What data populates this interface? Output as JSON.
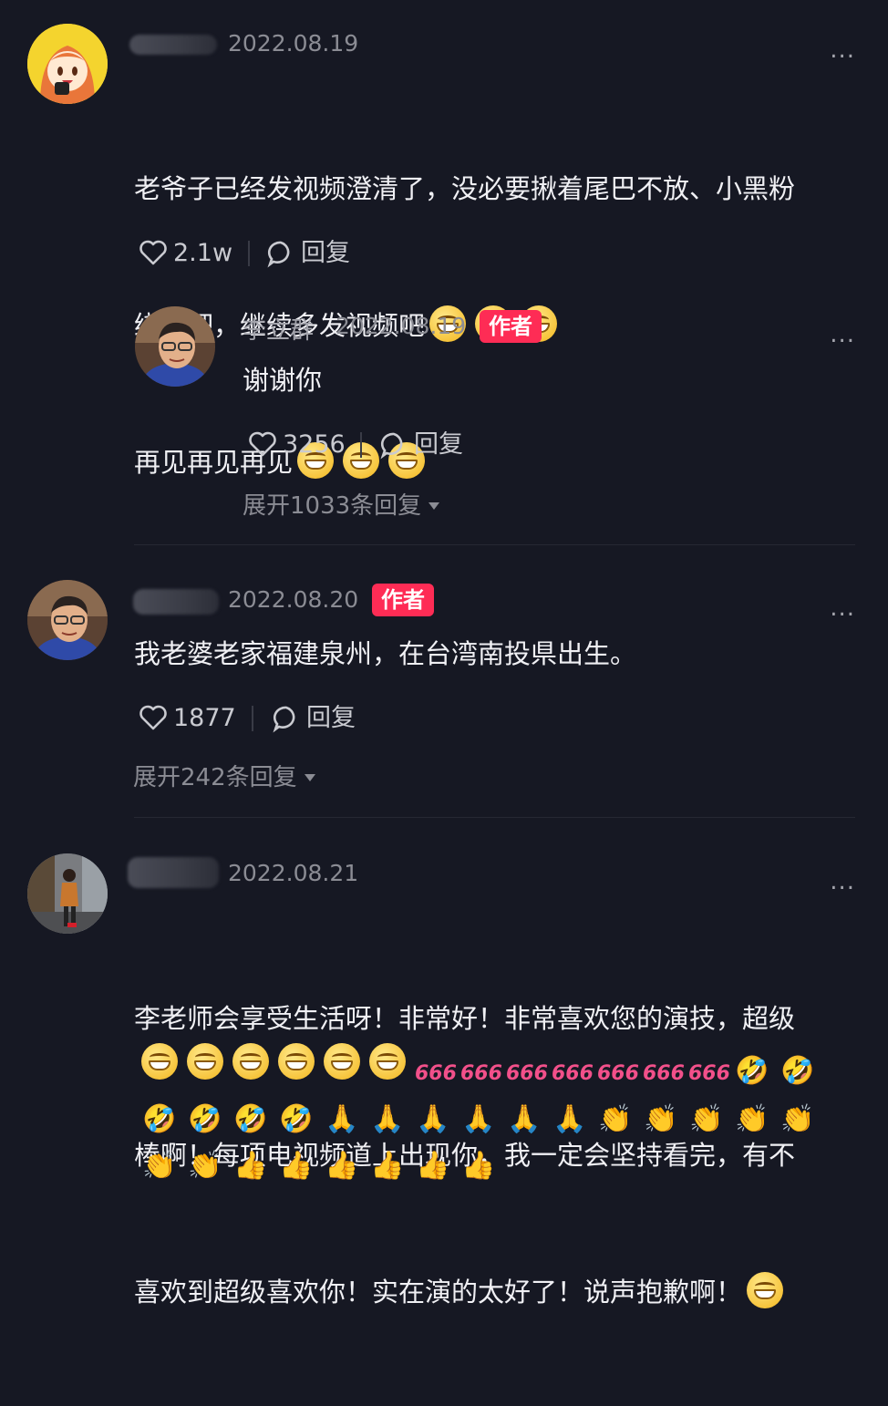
{
  "comments": [
    {
      "date": "2022.08.19",
      "text_line1": "老爷子已经发视频澄清了，没必要揪着尾巴不放、小黑粉",
      "text_line2": "绕行吧，继续多发视频吧",
      "text_line3": "再见再见再见",
      "likes": "2.1w",
      "reply_label": "回复",
      "more": "...",
      "reply": {
        "username": "李立群",
        "date": "2022.08.19",
        "badge": "作者",
        "text": "谢谢你",
        "likes": "3256",
        "reply_label": "回复",
        "expand": "展开1033条回复",
        "more": "..."
      }
    },
    {
      "date": "2022.08.20",
      "badge": "作者",
      "text": "我老婆老家福建泉州，在台湾南投県出生。",
      "likes": "1877",
      "reply_label": "回复",
      "expand": "展开242条回复",
      "more": "..."
    },
    {
      "date": "2022.08.21",
      "text_line1": "李老师会享受生活呀！非常好！非常喜欢您的演技，超级",
      "text_line2": "棒啊！每项电视频道上出现你，我一定会坚持看完，有不",
      "text_line3": "喜欢到超级喜欢你！实在演的太好了！说声抱歉啊！",
      "more": "...",
      "emoji_six": "666"
    }
  ],
  "icons": {
    "like": "heart-outline-icon",
    "reply": "speech-bubble-icon",
    "grin": "grin-emoji",
    "six": "666-emoji",
    "rofl": "rolling-laughing-emoji",
    "pray": "folded-hands-emoji",
    "clap": "clapping-hands-emoji",
    "thumb": "thumbs-up-emoji"
  },
  "colors": {
    "background": "#161823",
    "badge": "#fe2c55",
    "secondary_text": "#8b8c94"
  }
}
